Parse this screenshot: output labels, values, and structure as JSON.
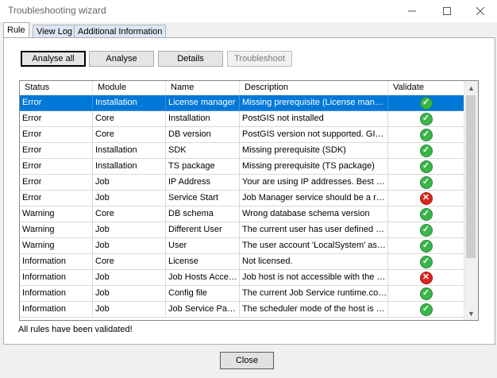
{
  "window": {
    "title": "Troubleshooting wizard",
    "minimize_icon": "minimize-icon",
    "maximize_icon": "maximize-icon",
    "close_icon": "close-icon"
  },
  "tabs": [
    {
      "label": "Rule",
      "active": true
    },
    {
      "label": "View Log",
      "active": false
    },
    {
      "label": "Additional Information",
      "active": false
    }
  ],
  "toolbar": {
    "analyse_all": "Analyse all",
    "analyse": "Analyse",
    "details": "Details",
    "troubleshoot": "Troubleshoot"
  },
  "grid": {
    "columns": [
      "Status",
      "Module",
      "Name",
      "Description",
      "Validate"
    ],
    "rows": [
      {
        "status": "Error",
        "module": "Installation",
        "name": "License manager",
        "description": "Missing prerequisite (License manager)",
        "validate": "ok",
        "selected": true
      },
      {
        "status": "Error",
        "module": "Core",
        "name": "Installation",
        "description": "PostGIS not installed",
        "validate": "ok"
      },
      {
        "status": "Error",
        "module": "Core",
        "name": "DB version",
        "description": "PostGIS version not supported. GIS man...",
        "validate": "ok"
      },
      {
        "status": "Error",
        "module": "Installation",
        "name": "SDK",
        "description": "Missing prerequisite (SDK)",
        "validate": "ok"
      },
      {
        "status": "Error",
        "module": "Installation",
        "name": "TS package",
        "description": "Missing prerequisite (TS package)",
        "validate": "ok"
      },
      {
        "status": "Error",
        "module": "Job",
        "name": "IP Address",
        "description": "Your are using IP addresses. Best practi...",
        "validate": "ok"
      },
      {
        "status": "Error",
        "module": "Job",
        "name": "Service Start",
        "description": "Job Manager service should be a runnin...",
        "validate": "error"
      },
      {
        "status": "Warning",
        "module": "Core",
        "name": "DB schema",
        "description": "Wrong database schema version",
        "validate": "ok"
      },
      {
        "status": "Warning",
        "module": "Job",
        "name": "Different User",
        "description": "The current user has user defined units ...",
        "validate": "ok"
      },
      {
        "status": "Warning",
        "module": "Job",
        "name": "User",
        "description": "The user account 'LocalSystem' assigne...",
        "validate": "ok"
      },
      {
        "status": "Information",
        "module": "Core",
        "name": "License",
        "description": "Not licensed.",
        "validate": "ok"
      },
      {
        "status": "Information",
        "module": "Job",
        "name": "Job Hosts Access...",
        "description": "Job host is not accessible with the user ...",
        "validate": "error"
      },
      {
        "status": "Information",
        "module": "Job",
        "name": "Config file",
        "description": "The current Job Service runtime.config d...",
        "validate": "ok"
      },
      {
        "status": "Information",
        "module": "Job",
        "name": "Job Service Paus...",
        "description": "The scheduler mode of the host is \"Paus...",
        "validate": "ok"
      }
    ]
  },
  "status_message": "All rules have been validated!",
  "footer": {
    "close": "Close"
  },
  "colors": {
    "selection": "#0078d7",
    "ok": "#3ab54a",
    "error": "#d9261c"
  }
}
